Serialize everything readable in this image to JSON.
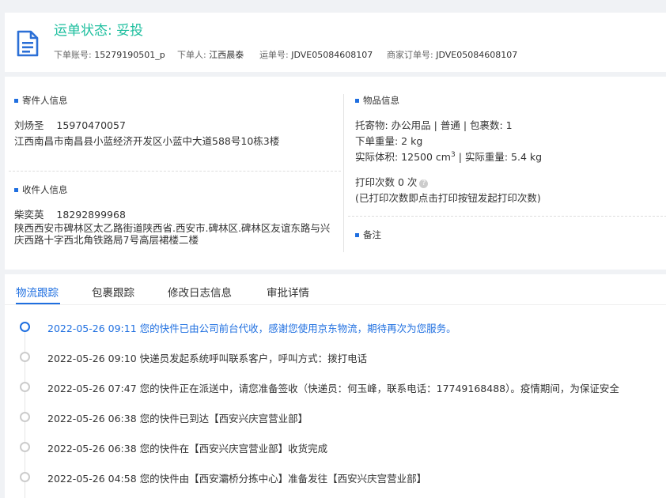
{
  "header": {
    "status_label": "运单状态: 妥投",
    "account_key": "下单账号:",
    "account": "15279190501_p",
    "orderer_key": "下单人:",
    "orderer": "江西晨泰",
    "waybill_key": "运单号:",
    "waybill": "JDVE05084608107",
    "merchant_order_key": "商家订单号:",
    "merchant_order": "JDVE05084608107"
  },
  "sender": {
    "section": "寄件人信息",
    "name": "刘炀圣",
    "phone": "15970470057",
    "address": "江西南昌市南昌县小蓝经济开发区小蓝中大道588号10栋3楼"
  },
  "receiver": {
    "section": "收件人信息",
    "name": "柴奕英",
    "phone": "18292899968",
    "address": "陕西西安市碑林区太乙路街道陕西省.西安市.碑林区.碑林区友谊东路与兴庆西路十字西北角铁路局7号高层裙楼二楼"
  },
  "goods": {
    "section": "物品信息",
    "line1": "托寄物:  办公用品 | 普通  |  包裹数:  1",
    "line2": "下单重量:  2 kg",
    "volume_label": "实际体积:    12500 cm",
    "volume_sup": "3",
    "weight_part": " |  实际重量:   5.4 kg",
    "print_count": "打印次数    0 次",
    "print_help": "?",
    "print_note": "(已打印次数即点击打印按钮发起打印次数)"
  },
  "remark": {
    "section": "备注"
  },
  "tabs": [
    "物流跟踪",
    "包裹跟踪",
    "修改日志信息",
    "审批详情"
  ],
  "timeline": [
    "2022-05-26 09:11  您的快件已由公司前台代收，感谢您使用京东物流，期待再次为您服务。",
    "2022-05-26 09:10  快递员发起系统呼叫联系客户，呼叫方式：拨打电话",
    "2022-05-26 07:47  您的快件正在派送中，请您准备签收（快递员：何玉峰，联系电话：17749168488）。疫情期间，为保证安全",
    "2022-05-26 06:38  您的快件已到达【西安兴庆宫营业部】",
    "2022-05-26 06:38  您的快件在【西安兴庆宫营业部】收货完成",
    "2022-05-26 04:58  您的快件由【西安灞桥分拣中心】准备发往【西安兴庆宫营业部】"
  ],
  "colors": {
    "status": "#1fbf9f",
    "accent": "#1f6fe0",
    "icon": "#2b6fd6"
  }
}
